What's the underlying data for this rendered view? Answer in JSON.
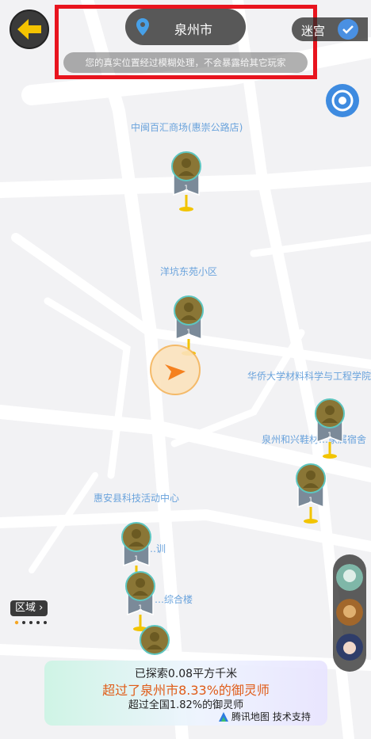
{
  "location": {
    "city": "泉州市",
    "notice": "您的真实位置经过模糊处理，不会暴露给其它玩家"
  },
  "top_right": {
    "maze_label": "迷宫"
  },
  "map": {
    "pois": [
      "中闽百汇商场(惠崇公路店)",
      "洋坑东苑小区",
      "华侨大学材料科学与工程学院",
      "泉州和兴鞋材…家属宿舍",
      "惠安县科技活动中心",
      "…训",
      "…综合楼"
    ],
    "marker_count_label": "1"
  },
  "region": {
    "label": "区域"
  },
  "stats": {
    "explored": "已探索0.08平方千米",
    "city_rank": "超过了泉州市8.33%的御灵师",
    "nation_rank": "超过全国1.82%的御灵师"
  },
  "credit": "腾讯地图 技术支持",
  "colors": {
    "accent_blue": "#3e8be0",
    "rank_orange": "#e05c18",
    "highlight_red": "#e8141e"
  }
}
